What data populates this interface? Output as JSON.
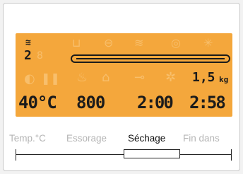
{
  "display": {
    "level_indicator": "2",
    "weight_value": "1,5",
    "weight_unit": "kg",
    "temperature": "40°C",
    "spin_speed": "800",
    "drying_time": "2:00",
    "finish_in": "2:58",
    "progress_fraction": 0.0
  },
  "buttons": {
    "temp": "Temp.°C",
    "spin": "Essorage",
    "drying": "Séchage",
    "finish": "Fin dans",
    "selected": "Séchage"
  },
  "colors": {
    "lcd_background": "#f4a73c",
    "segment_on": "#1b1b1b",
    "segment_off": "#f8bf6c"
  },
  "icons": [
    "basket-icon",
    "tub-icon",
    "drum-icon",
    "wash-icon",
    "spiral-icon",
    "sun-icon",
    "stain-icon",
    "pause-icon",
    "tap-icon",
    "delicate-icon",
    "key-icon",
    "snowflake-icon"
  ]
}
